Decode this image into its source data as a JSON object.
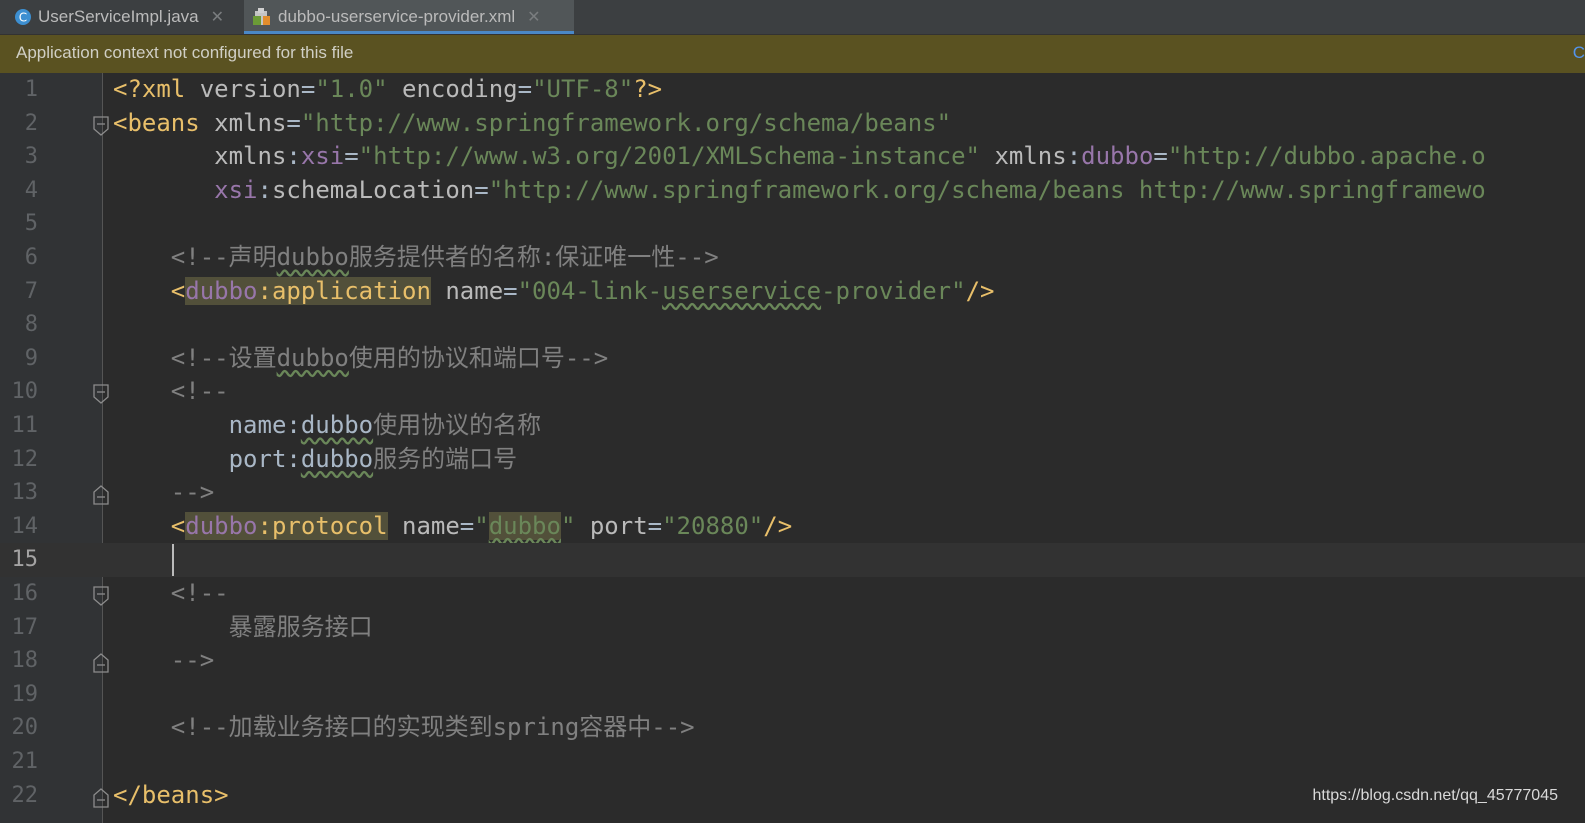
{
  "tabs": [
    {
      "label": "UserServiceImpl.java",
      "icon": "java-class-icon",
      "active": false
    },
    {
      "label": "dubbo-userservice-provider.xml",
      "icon": "xml-file-icon",
      "active": true
    }
  ],
  "notice": {
    "message": "Application context not configured for this file",
    "action_label": "C"
  },
  "editor": {
    "current_line": 15,
    "lines": [
      {
        "n": "1"
      },
      {
        "n": "2"
      },
      {
        "n": "3"
      },
      {
        "n": "4"
      },
      {
        "n": "5"
      },
      {
        "n": "6"
      },
      {
        "n": "7"
      },
      {
        "n": "8"
      },
      {
        "n": "9"
      },
      {
        "n": "10"
      },
      {
        "n": "11"
      },
      {
        "n": "12"
      },
      {
        "n": "13"
      },
      {
        "n": "14"
      },
      {
        "n": "15"
      },
      {
        "n": "16"
      },
      {
        "n": "17"
      },
      {
        "n": "18"
      },
      {
        "n": "19"
      },
      {
        "n": "20"
      },
      {
        "n": "21"
      },
      {
        "n": "22"
      }
    ],
    "code": {
      "l1": {
        "open": "<?xml ",
        "version_attr": "version",
        "eq": "=",
        "version_val": "\"1.0\"",
        "sp": " ",
        "enc_attr": "encoding",
        "eq2": "=",
        "enc_val": "\"UTF-8\"",
        "close": "?>"
      },
      "l2": {
        "open": "<beans ",
        "attr": "xmlns",
        "eq": "=",
        "val": "\"http://www.springframework.org/schema/beans\""
      },
      "l3": {
        "indent": "       ",
        "a1": "xmlns",
        "c1": ":",
        "n1": "xsi",
        "eq1": "=",
        "v1": "\"http://www.w3.org/2001/XMLSchema-instance\"",
        "sp": " ",
        "a2": "xmlns",
        "c2": ":",
        "n2": "dubbo",
        "eq2": "=",
        "v2": "\"http://dubbo.apache.o"
      },
      "l4": {
        "indent": "       ",
        "n1": "xsi",
        "c1": ":",
        "a1": "schemaLocation",
        "eq1": "=",
        "v1": "\"http://www.springframework.org/schema/beans http://www.springframewo"
      },
      "l6": {
        "indent": "    ",
        "pre": "<!--声明",
        "word": "dubbo",
        "post": "服务提供者的名称:保证唯一性-->"
      },
      "l7": {
        "indent": "    ",
        "lt": "<",
        "ns": "dubbo",
        "colon": ":",
        "tag": "application",
        "sp": " ",
        "attr": "name",
        "eq": "=",
        "v_pre": "\"004-link-",
        "v_typo": "userservice",
        "v_post": "-provider\"",
        "close": "/>"
      },
      "l9": {
        "indent": "    ",
        "pre": "<!--设置",
        "word": "dubbo",
        "post": "使用的协议和端口号-->"
      },
      "l10": {
        "indent": "    ",
        "text": "<!--"
      },
      "l11": {
        "indent": "        ",
        "pre": "name:",
        "word": "dubbo",
        "post": "使用协议的名称"
      },
      "l12": {
        "indent": "        ",
        "pre": "port:",
        "word": "dubbo",
        "post": "服务的端口号"
      },
      "l13": {
        "indent": "    ",
        "text": "-->"
      },
      "l14": {
        "indent": "    ",
        "lt": "<",
        "ns": "dubbo",
        "colon": ":",
        "tag": "protocol",
        "sp": " ",
        "a1": "name",
        "eq1": "=",
        "q1": "\"",
        "v1": "dubbo",
        "q2": "\"",
        "sp2": " ",
        "a2": "port",
        "eq2": "=",
        "v2": "\"20880\"",
        "close": "/>"
      },
      "l16": {
        "indent": "    ",
        "text": "<!--"
      },
      "l17": {
        "indent": "        ",
        "text": "暴露服务接口"
      },
      "l18": {
        "indent": "    ",
        "text": "-->"
      },
      "l20": {
        "indent": "    ",
        "text": "<!--加载业务接口的实现类到spring容器中-->"
      },
      "l22": {
        "text": "</beans>"
      }
    }
  },
  "watermark": "https://blog.csdn.net/qq_45777045",
  "colors": {
    "background": "#2b2b2b",
    "gutter": "#313335",
    "notice": "#5a5221",
    "tag": "#e8bf6a",
    "string": "#6a8759",
    "comment": "#808080",
    "namespace": "#9876aa"
  }
}
